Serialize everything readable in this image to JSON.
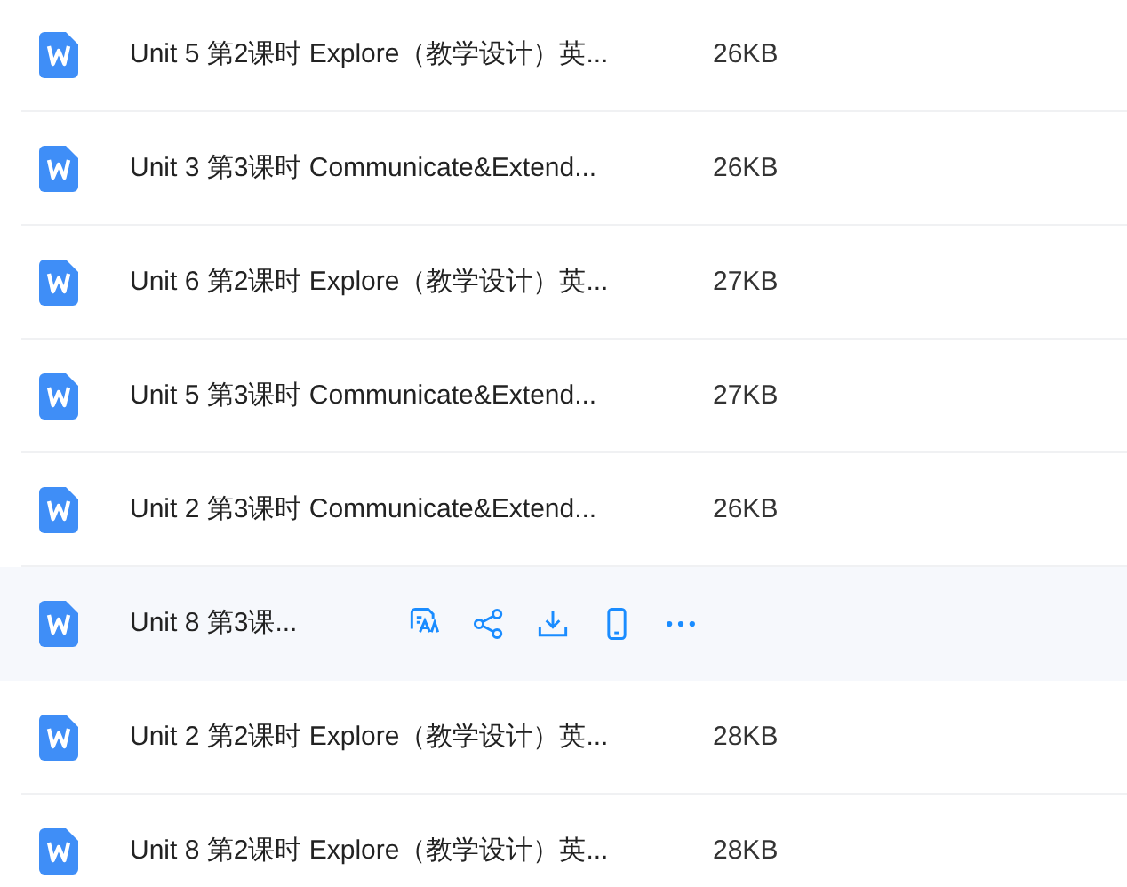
{
  "files": [
    {
      "name": "Unit 5 第2课时 Explore（教学设计）英...",
      "size": "26KB",
      "hovered": false
    },
    {
      "name": "Unit 3 第3课时 Communicate&Extend...",
      "size": "26KB",
      "hovered": false
    },
    {
      "name": "Unit 6 第2课时 Explore（教学设计）英...",
      "size": "27KB",
      "hovered": false
    },
    {
      "name": "Unit 5 第3课时 Communicate&Extend...",
      "size": "27KB",
      "hovered": false
    },
    {
      "name": "Unit 2 第3课时 Communicate&Extend...",
      "size": "26KB",
      "hovered": false
    },
    {
      "name": "Unit 8 第3课...",
      "hovered": true,
      "actions": [
        {
          "kind": "translate"
        },
        {
          "kind": "share"
        },
        {
          "kind": "download"
        },
        {
          "kind": "phone"
        },
        {
          "kind": "more"
        }
      ]
    },
    {
      "name": "Unit 2 第2课时 Explore（教学设计）英...",
      "size": "28KB",
      "hovered": false
    },
    {
      "name": "Unit 8 第2课时 Explore（教学设计）英...",
      "size": "28KB",
      "hovered": false
    }
  ]
}
